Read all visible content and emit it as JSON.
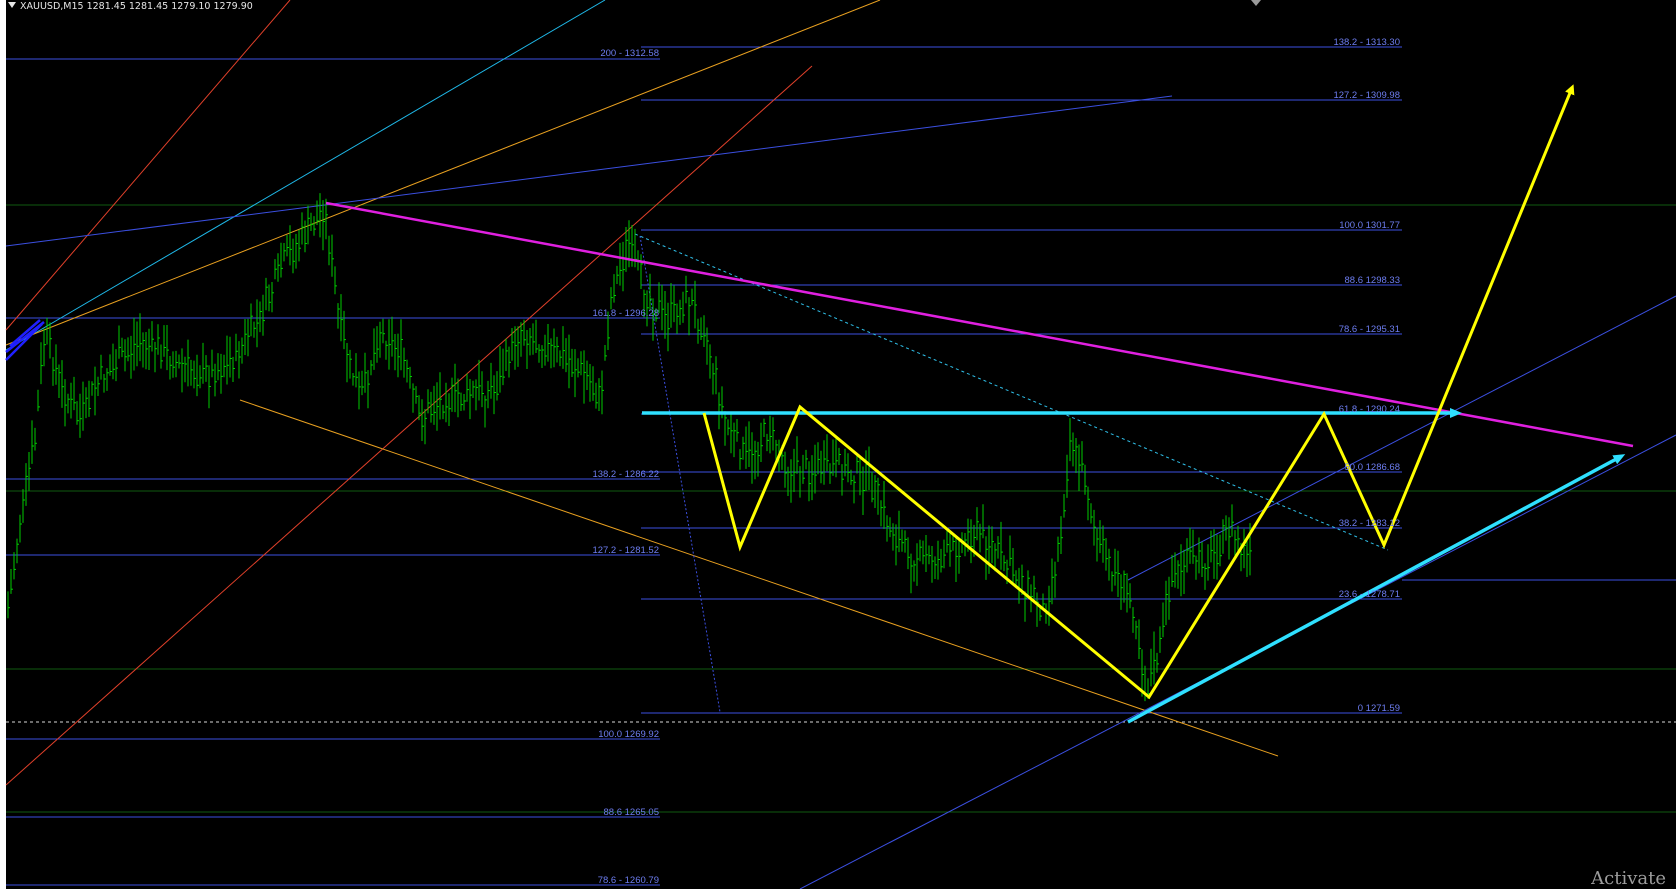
{
  "window": {
    "symbol_info": "XAUUSD,M15  1281.45 1281.45 1279.10 1279.90",
    "watermark": "Activate",
    "collapse_icon": "chevron-down-icon"
  },
  "colors": {
    "background": "#000000",
    "candles": "#00cc00",
    "fib_levels": "#3b4fe0",
    "fib_labels": "#6d7df0",
    "magenta_trendline": "#e020e0",
    "cyan_arrows": "#2fe0ff",
    "yellow_path": "#ffff00",
    "orange_channel": "#e8a020",
    "red_fan": "#e0402a",
    "grid_green": "#0f5a0f"
  },
  "fib_left": [
    {
      "label": "200 - 1312.58"
    },
    {
      "label": "161.8 - 1296.28"
    },
    {
      "label": "138.2 - 1286.22"
    },
    {
      "label": "127.2 - 1281.52"
    },
    {
      "label": "100.0 1269.92"
    },
    {
      "label": "88.6 1265.05"
    },
    {
      "label": "78.6 - 1260.79"
    }
  ],
  "fib_right": [
    {
      "label": "138.2 - 1313.30"
    },
    {
      "label": "127.2 - 1309.98"
    },
    {
      "label": "100.0 1301.77"
    },
    {
      "label": "88.6 1298.33"
    },
    {
      "label": "78.6 - 1295.31"
    },
    {
      "label": "61.8 - 1290.24"
    },
    {
      "label": "50.0 1286.68"
    },
    {
      "label": "38.2 - 1283.12"
    },
    {
      "label": "23.6 - 1278.71"
    },
    {
      "label": "0 1271.59"
    }
  ]
}
